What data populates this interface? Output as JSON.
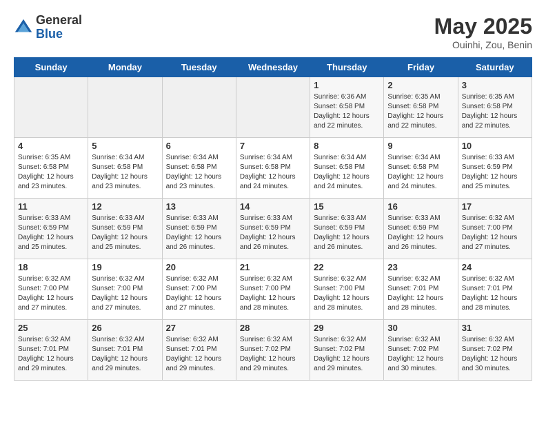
{
  "header": {
    "logo_general": "General",
    "logo_blue": "Blue",
    "title": "May 2025",
    "subtitle": "Ouinhi, Zou, Benin"
  },
  "days_of_week": [
    "Sunday",
    "Monday",
    "Tuesday",
    "Wednesday",
    "Thursday",
    "Friday",
    "Saturday"
  ],
  "weeks": [
    [
      {
        "day": "",
        "info": ""
      },
      {
        "day": "",
        "info": ""
      },
      {
        "day": "",
        "info": ""
      },
      {
        "day": "",
        "info": ""
      },
      {
        "day": "1",
        "info": "Sunrise: 6:36 AM\nSunset: 6:58 PM\nDaylight: 12 hours\nand 22 minutes."
      },
      {
        "day": "2",
        "info": "Sunrise: 6:35 AM\nSunset: 6:58 PM\nDaylight: 12 hours\nand 22 minutes."
      },
      {
        "day": "3",
        "info": "Sunrise: 6:35 AM\nSunset: 6:58 PM\nDaylight: 12 hours\nand 22 minutes."
      }
    ],
    [
      {
        "day": "4",
        "info": "Sunrise: 6:35 AM\nSunset: 6:58 PM\nDaylight: 12 hours\nand 23 minutes."
      },
      {
        "day": "5",
        "info": "Sunrise: 6:34 AM\nSunset: 6:58 PM\nDaylight: 12 hours\nand 23 minutes."
      },
      {
        "day": "6",
        "info": "Sunrise: 6:34 AM\nSunset: 6:58 PM\nDaylight: 12 hours\nand 23 minutes."
      },
      {
        "day": "7",
        "info": "Sunrise: 6:34 AM\nSunset: 6:58 PM\nDaylight: 12 hours\nand 24 minutes."
      },
      {
        "day": "8",
        "info": "Sunrise: 6:34 AM\nSunset: 6:58 PM\nDaylight: 12 hours\nand 24 minutes."
      },
      {
        "day": "9",
        "info": "Sunrise: 6:34 AM\nSunset: 6:58 PM\nDaylight: 12 hours\nand 24 minutes."
      },
      {
        "day": "10",
        "info": "Sunrise: 6:33 AM\nSunset: 6:59 PM\nDaylight: 12 hours\nand 25 minutes."
      }
    ],
    [
      {
        "day": "11",
        "info": "Sunrise: 6:33 AM\nSunset: 6:59 PM\nDaylight: 12 hours\nand 25 minutes."
      },
      {
        "day": "12",
        "info": "Sunrise: 6:33 AM\nSunset: 6:59 PM\nDaylight: 12 hours\nand 25 minutes."
      },
      {
        "day": "13",
        "info": "Sunrise: 6:33 AM\nSunset: 6:59 PM\nDaylight: 12 hours\nand 26 minutes."
      },
      {
        "day": "14",
        "info": "Sunrise: 6:33 AM\nSunset: 6:59 PM\nDaylight: 12 hours\nand 26 minutes."
      },
      {
        "day": "15",
        "info": "Sunrise: 6:33 AM\nSunset: 6:59 PM\nDaylight: 12 hours\nand 26 minutes."
      },
      {
        "day": "16",
        "info": "Sunrise: 6:33 AM\nSunset: 6:59 PM\nDaylight: 12 hours\nand 26 minutes."
      },
      {
        "day": "17",
        "info": "Sunrise: 6:32 AM\nSunset: 7:00 PM\nDaylight: 12 hours\nand 27 minutes."
      }
    ],
    [
      {
        "day": "18",
        "info": "Sunrise: 6:32 AM\nSunset: 7:00 PM\nDaylight: 12 hours\nand 27 minutes."
      },
      {
        "day": "19",
        "info": "Sunrise: 6:32 AM\nSunset: 7:00 PM\nDaylight: 12 hours\nand 27 minutes."
      },
      {
        "day": "20",
        "info": "Sunrise: 6:32 AM\nSunset: 7:00 PM\nDaylight: 12 hours\nand 27 minutes."
      },
      {
        "day": "21",
        "info": "Sunrise: 6:32 AM\nSunset: 7:00 PM\nDaylight: 12 hours\nand 28 minutes."
      },
      {
        "day": "22",
        "info": "Sunrise: 6:32 AM\nSunset: 7:00 PM\nDaylight: 12 hours\nand 28 minutes."
      },
      {
        "day": "23",
        "info": "Sunrise: 6:32 AM\nSunset: 7:01 PM\nDaylight: 12 hours\nand 28 minutes."
      },
      {
        "day": "24",
        "info": "Sunrise: 6:32 AM\nSunset: 7:01 PM\nDaylight: 12 hours\nand 28 minutes."
      }
    ],
    [
      {
        "day": "25",
        "info": "Sunrise: 6:32 AM\nSunset: 7:01 PM\nDaylight: 12 hours\nand 29 minutes."
      },
      {
        "day": "26",
        "info": "Sunrise: 6:32 AM\nSunset: 7:01 PM\nDaylight: 12 hours\nand 29 minutes."
      },
      {
        "day": "27",
        "info": "Sunrise: 6:32 AM\nSunset: 7:01 PM\nDaylight: 12 hours\nand 29 minutes."
      },
      {
        "day": "28",
        "info": "Sunrise: 6:32 AM\nSunset: 7:02 PM\nDaylight: 12 hours\nand 29 minutes."
      },
      {
        "day": "29",
        "info": "Sunrise: 6:32 AM\nSunset: 7:02 PM\nDaylight: 12 hours\nand 29 minutes."
      },
      {
        "day": "30",
        "info": "Sunrise: 6:32 AM\nSunset: 7:02 PM\nDaylight: 12 hours\nand 30 minutes."
      },
      {
        "day": "31",
        "info": "Sunrise: 6:32 AM\nSunset: 7:02 PM\nDaylight: 12 hours\nand 30 minutes."
      }
    ]
  ]
}
